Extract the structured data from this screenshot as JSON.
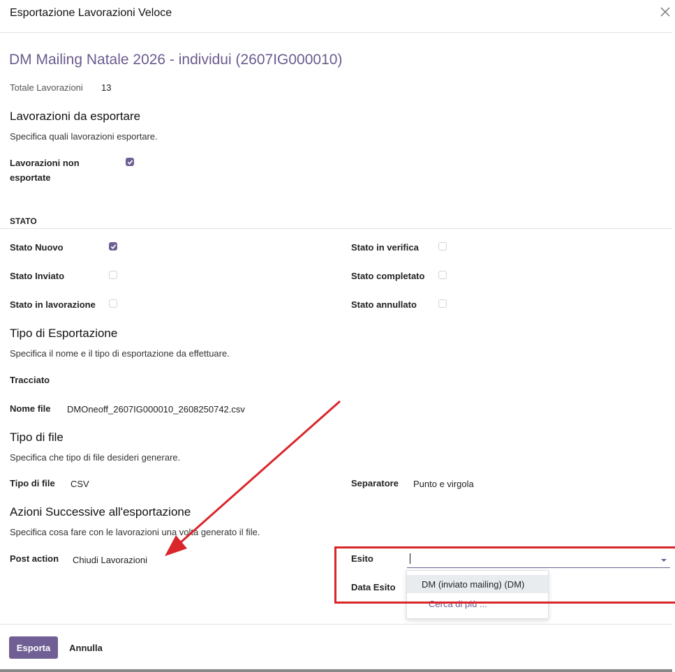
{
  "dialog": {
    "title": "Esportazione Lavorazioni Veloce"
  },
  "record": {
    "title": "DM Mailing Natale 2026 - individui (2607IG000010)",
    "totale_label": "Totale Lavorazioni",
    "totale_value": "13"
  },
  "lavorazioni": {
    "title": "Lavorazioni da esportare",
    "description": "Specifica quali lavorazioni esportare.",
    "non_esportate_label_line1": "Lavorazioni non",
    "non_esportate_label_line2": "esportate",
    "non_esportate_checked": true
  },
  "stato": {
    "title": "STATO",
    "items": [
      {
        "label": "Stato Nuovo",
        "checked": true
      },
      {
        "label": "Stato Inviato",
        "checked": false
      },
      {
        "label": "Stato in lavorazione",
        "checked": false
      },
      {
        "label": "Stato in verifica",
        "checked": false
      },
      {
        "label": "Stato completato",
        "checked": false
      },
      {
        "label": "Stato annullato",
        "checked": false
      }
    ]
  },
  "tipo_esportazione": {
    "title": "Tipo di Esportazione",
    "description": "Specifica il nome e il tipo di esportazione da effettuare.",
    "tracciato_label": "Tracciato",
    "nome_file_label": "Nome file",
    "nome_file_value": "DMOneoff_2607IG000010_2608250742.csv"
  },
  "tipo_file": {
    "title": "Tipo di file",
    "description": "Specifica che tipo di file desideri generare.",
    "tipo_label": "Tipo di file",
    "tipo_value": "CSV",
    "separatore_label": "Separatore",
    "separatore_value": "Punto e virgola"
  },
  "azioni": {
    "title": "Azioni Successive all'esportazione",
    "description": "Specifica cosa fare con le lavorazioni una volta generato il file.",
    "post_action_label": "Post action",
    "post_action_value": "Chiudi Lavorazioni",
    "esito_label": "Esito",
    "esito_value": "",
    "data_esito_label": "Data Esito",
    "dropdown_options": [
      "DM (inviato mailing) (DM)",
      "Cerca di più ..."
    ]
  },
  "footer": {
    "export_button": "Esporta",
    "cancel_button": "Annulla"
  },
  "colors": {
    "accent": "#6f5f94",
    "title": "#6b5b8e",
    "annotation": "#d9262b"
  }
}
